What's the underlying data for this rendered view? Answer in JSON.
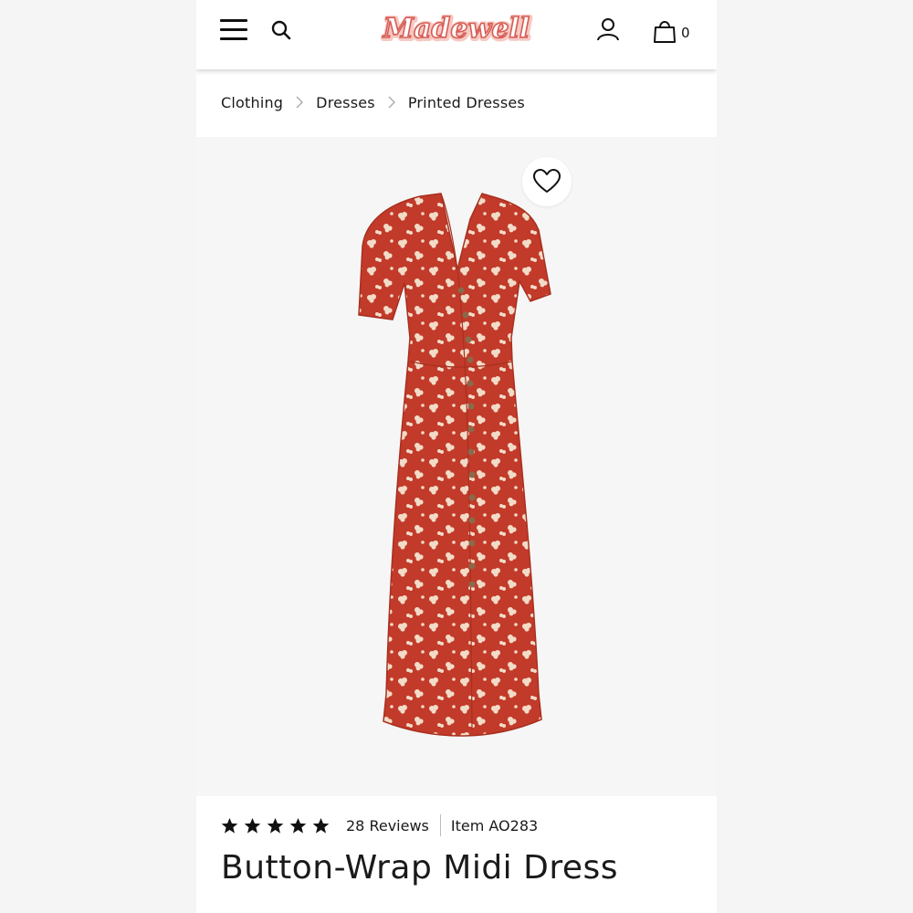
{
  "header": {
    "brand": "Madewell",
    "bag_count": "0",
    "icons": [
      "menu-icon",
      "search-icon",
      "account-icon",
      "bag-icon"
    ]
  },
  "breadcrumb": [
    "Clothing",
    "Dresses",
    "Printed Dresses"
  ],
  "product": {
    "rating_stars": 5,
    "reviews": "28 Reviews",
    "item": "Item AO283",
    "title": "Button-Wrap Midi Dress"
  },
  "colors": {
    "brand_pink": "#f0a8a2",
    "brand_red": "#c0302a",
    "dress_red": "#c23a2a",
    "print_cream": "#f2dcc8"
  }
}
